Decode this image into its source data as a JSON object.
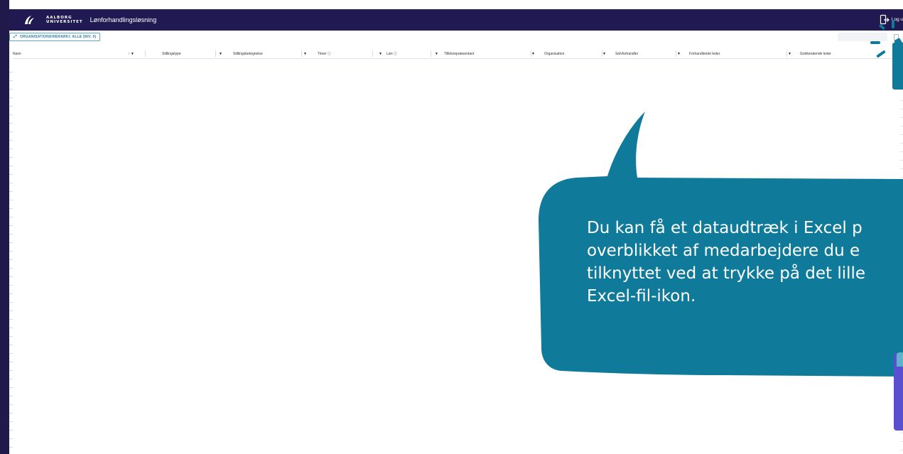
{
  "header": {
    "university_line1": "AALBORG",
    "university_line2": "UNIVERSITET",
    "app_title": "Lønforhandlingsløsning",
    "logout_label": "Log u",
    "logout_icon": "logout-icon"
  },
  "toolbar": {
    "hierarchy_chip_label": "ORGANISATIONSHIERARKI: ALLE (NIV. 0)",
    "expand_icon": "expand-arrows-icon",
    "excel_icon": "excel-file-icon"
  },
  "table": {
    "columns": [
      {
        "label": "Navn",
        "icons": "↑ ▼"
      },
      {
        "label": "Stillingstype",
        "icons": "▼"
      },
      {
        "label": "Stillingsbetegnelse",
        "icons": "▼"
      },
      {
        "label": "Timer ⓘ",
        "icons": "▼"
      },
      {
        "label": "Løn ⓘ",
        "icons": "▼"
      },
      {
        "label": "Tillidsrepræsentant",
        "icons": "▼"
      },
      {
        "label": "Organisation",
        "icons": "▼"
      },
      {
        "label": "Selvforhandler",
        "icons": "▼"
      },
      {
        "label": "Forhandlende leder",
        "icons": "▼"
      },
      {
        "label": "Godkendende leder",
        "icons": ""
      }
    ]
  },
  "tooltip": {
    "lines": [
      "Du kan få et dataudtræk i Excel p",
      "overblikket af medarbejdere du e",
      "tilknyttet ved at trykke på det lille",
      "Excel-fil-ikon."
    ]
  },
  "colors": {
    "header_bg": "#211a52",
    "bubble_bg": "#0f7a9a",
    "accent_purple": "#5a4fcf",
    "chip_text": "#2f7da3"
  }
}
